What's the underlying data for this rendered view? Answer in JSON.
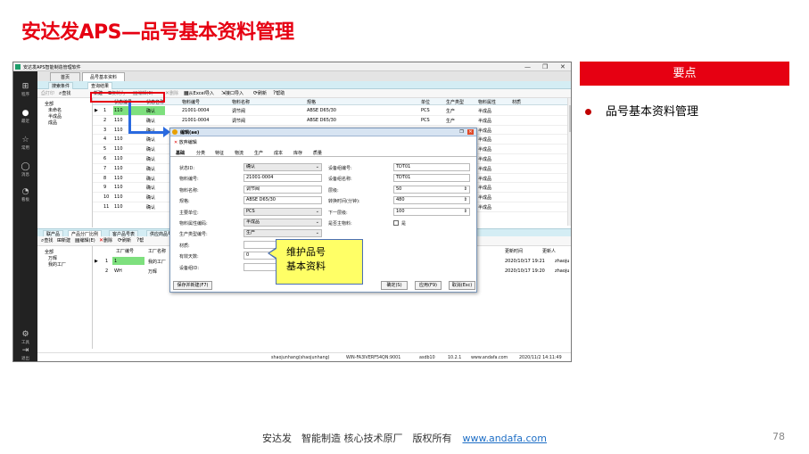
{
  "slide": {
    "title": "安达发APS—品号基本资料管理",
    "key_points_header": "要点",
    "key_point": "品号基本资料管理",
    "footer_text": "安达发　智能制造 核心技术原厂　版权所有",
    "footer_link": "www.andafa.com",
    "page_number": "78",
    "callout_line1": "维护品号",
    "callout_line2": "基本资料"
  },
  "app": {
    "window_title": "安达发APS智能制造管理软件",
    "window_buttons": {
      "min": "—",
      "max": "❐",
      "close": "✕"
    },
    "sidebar": [
      {
        "icon": "grid-icon",
        "glyph": "⊞",
        "label": "程序"
      },
      {
        "icon": "clock-icon",
        "glyph": "●",
        "label": "最近"
      },
      {
        "icon": "star-icon",
        "glyph": "☆",
        "label": "常用"
      },
      {
        "icon": "message-icon",
        "glyph": "◯",
        "label": "消息"
      },
      {
        "icon": "dashboard-icon",
        "glyph": "◔",
        "label": "看板"
      }
    ],
    "sidebar_bottom": [
      {
        "icon": "gear-icon",
        "glyph": "⚙",
        "label": "工具"
      },
      {
        "icon": "logout-icon",
        "glyph": "⇥",
        "label": "退出"
      }
    ],
    "tabs": [
      "首页",
      "品号基本资料"
    ],
    "page_tabs": [
      "搜索条件",
      "查询结果"
    ],
    "toolbar": {
      "print": "打印",
      "query": "查找",
      "new": "新建",
      "copy": "复制为",
      "edit": "编辑(E)",
      "delete": "删除",
      "excel_import": "从Excel导入",
      "interface_import": "接口导入",
      "refresh": "刷新",
      "help": "帮助"
    },
    "tree": [
      "全部",
      "未命名",
      "半成品",
      "成品"
    ],
    "grid_headers": [
      "状态编号",
      "状态名称",
      "物料编号",
      "物料名称",
      "规格",
      "单位",
      "生产类型",
      "物料属性",
      "材质"
    ],
    "grid_rows": [
      {
        "n": "1",
        "code": "110",
        "status": "确认",
        "item": "21001-0004",
        "name": "调节阀",
        "spec": "ABSE D65/30",
        "unit": "PCS",
        "ptype": "生产",
        "attr": "半成品"
      },
      {
        "n": "2",
        "code": "110",
        "status": "确认",
        "item": "21001-0004",
        "name": "调节阀",
        "spec": "ABSE D65/30",
        "unit": "PCS",
        "ptype": "生产",
        "attr": "半成品"
      },
      {
        "n": "3",
        "code": "110",
        "status": "确认",
        "item": "",
        "name": "",
        "spec": "",
        "unit": "",
        "ptype": "",
        "attr": "半成品"
      },
      {
        "n": "4",
        "code": "110",
        "status": "确认",
        "item": "",
        "name": "",
        "spec": "",
        "unit": "",
        "ptype": "",
        "attr": "半成品"
      },
      {
        "n": "5",
        "code": "110",
        "status": "确认",
        "item": "",
        "name": "",
        "spec": "",
        "unit": "",
        "ptype": "",
        "attr": "半成品"
      },
      {
        "n": "6",
        "code": "110",
        "status": "确认",
        "item": "",
        "name": "",
        "spec": "",
        "unit": "",
        "ptype": "",
        "attr": "半成品"
      },
      {
        "n": "7",
        "code": "110",
        "status": "确认",
        "item": "",
        "name": "",
        "spec": "",
        "unit": "",
        "ptype": "",
        "attr": "半成品"
      },
      {
        "n": "8",
        "code": "110",
        "status": "确认",
        "item": "",
        "name": "",
        "spec": "",
        "unit": "",
        "ptype": "",
        "attr": "半成品"
      },
      {
        "n": "9",
        "code": "110",
        "status": "确认",
        "item": "",
        "name": "",
        "spec": "",
        "unit": "",
        "ptype": "",
        "attr": "半成品"
      },
      {
        "n": "10",
        "code": "110",
        "status": "确认",
        "item": "",
        "name": "",
        "spec": "",
        "unit": "",
        "ptype": "",
        "attr": "半成品"
      },
      {
        "n": "11",
        "code": "110",
        "status": "确认",
        "item": "",
        "name": "",
        "spec": "",
        "unit": "",
        "ptype": "",
        "attr": "半成品"
      }
    ],
    "bottom_tabs": [
      "联产品",
      "产品分厂比例",
      "客户品号表",
      "供应商品号表"
    ],
    "bottom_toolbar": {
      "query": "查找",
      "new": "新建",
      "edit": "编辑(E)",
      "delete": "删除",
      "refresh": "刷新",
      "help": "帮"
    },
    "bottom_tree": [
      "全部",
      "万辉",
      "我的工厂"
    ],
    "bottom_headers": [
      "工厂编号",
      "工厂名称",
      "更新时间",
      "更新人"
    ],
    "bottom_rows": [
      {
        "n": "1",
        "code": "1",
        "name": "我的工厂",
        "time": "2020/10/17 19:21",
        "user": "zhaoju"
      },
      {
        "n": "2",
        "code": "WH",
        "name": "万辉",
        "time": "2020/10/17 19:20",
        "user": "zhaoju"
      }
    ],
    "status": {
      "user": "shaojunhang(shaojunhang)",
      "host": "WIN-FA3IVERF54QN:9001",
      "db": "asdb10",
      "ip": "10.2.1",
      "site": "www.andafa.com",
      "time": "2020/11/2 14:11:49"
    }
  },
  "dialog": {
    "title": "编辑(ae)",
    "cancel_edit": "放弃编辑",
    "tabs": [
      "基础",
      "分类",
      "特征",
      "物流",
      "生产",
      "成本",
      "库存",
      "质量"
    ],
    "left_fields": [
      {
        "label": "状态ID:",
        "value": "确认",
        "type": "select"
      },
      {
        "label": "物料编号:",
        "value": "21001-0004",
        "type": "text"
      },
      {
        "label": "物料名称:",
        "value": "调节阀",
        "type": "text"
      },
      {
        "label": "规格:",
        "value": "ABSE D65/30",
        "type": "text"
      },
      {
        "label": "主要单位:",
        "value": "PCS",
        "type": "select"
      },
      {
        "label": "物料属性编码:",
        "value": "半成品",
        "type": "select"
      },
      {
        "label": "生产类型编号:",
        "value": "生产",
        "type": "select"
      },
      {
        "label": "材质:",
        "value": "",
        "type": "text"
      },
      {
        "label": "有效天数:",
        "value": "0",
        "type": "text"
      },
      {
        "label": "设备组ID:",
        "value": "",
        "type": "text"
      }
    ],
    "right_fields": [
      {
        "label": "设备组编号:",
        "value": "TDT01",
        "type": "text"
      },
      {
        "label": "设备组名称:",
        "value": "TDT01",
        "type": "text"
      },
      {
        "label": "层级:",
        "value": "50",
        "type": "spin"
      },
      {
        "label": "转换时间(分钟):",
        "value": "480",
        "type": "spin"
      },
      {
        "label": "下一层级:",
        "value": "100",
        "type": "spin"
      },
      {
        "label": "是否主物料:",
        "value": "是",
        "type": "check"
      }
    ],
    "buttons": {
      "save_new": "保存并新建(F7)",
      "ok": "确定(S)",
      "apply": "应用(F9)",
      "cancel": "取消(Esc)"
    }
  }
}
